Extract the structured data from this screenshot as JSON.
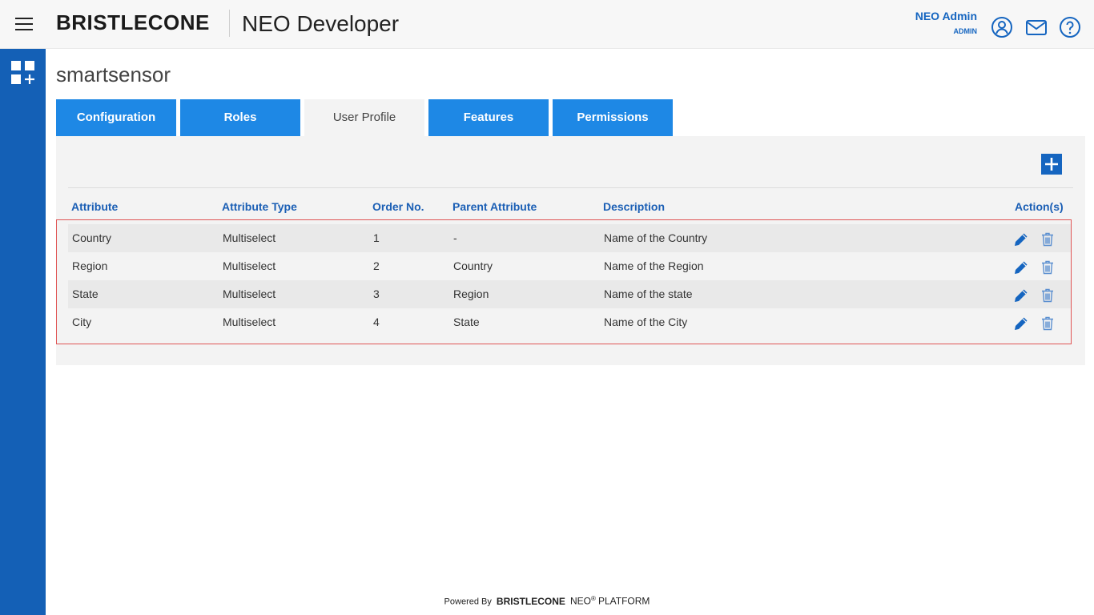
{
  "header": {
    "logo_text": "BRISTLECONE",
    "app_title": "NEO Developer",
    "user_name": "NEO Admin",
    "user_role": "ADMIN",
    "icons": [
      "menu-icon",
      "user-circle-icon",
      "mail-icon",
      "help-icon"
    ]
  },
  "sidebar": {
    "icons": [
      "apps-grid-plus-icon"
    ]
  },
  "page": {
    "title": "smartsensor"
  },
  "tabs": [
    {
      "label": "Configuration",
      "active": false
    },
    {
      "label": "Roles",
      "active": false
    },
    {
      "label": "User Profile",
      "active": true
    },
    {
      "label": "Features",
      "active": false
    },
    {
      "label": "Permissions",
      "active": false
    }
  ],
  "table": {
    "add_icon": "plus-square-icon",
    "columns": [
      "Attribute",
      "Attribute Type",
      "Order No.",
      "Parent Attribute",
      "Description",
      "Action(s)"
    ],
    "rows": [
      {
        "attribute": "Country",
        "type": "Multiselect",
        "order": "1",
        "parent": "-",
        "description": "Name of the Country"
      },
      {
        "attribute": "Region",
        "type": "Multiselect",
        "order": "2",
        "parent": "Country",
        "description": "Name of the Region"
      },
      {
        "attribute": "State",
        "type": "Multiselect",
        "order": "3",
        "parent": "Region",
        "description": "Name of the state"
      },
      {
        "attribute": "City",
        "type": "Multiselect",
        "order": "4",
        "parent": "State",
        "description": "Name of the City"
      }
    ],
    "row_action_icons": [
      "pencil-icon",
      "trash-icon"
    ]
  },
  "footer": {
    "powered_by": "Powered By",
    "brand": "BRISTLECONE",
    "neo": "NEO",
    "registered": "®",
    "platform": "PLATFORM"
  },
  "colors": {
    "accent_blue": "#1e88e5",
    "sidebar_blue": "#1460b6",
    "header_text_blue": "#1b5fb5",
    "highlight_border": "#e05555"
  }
}
